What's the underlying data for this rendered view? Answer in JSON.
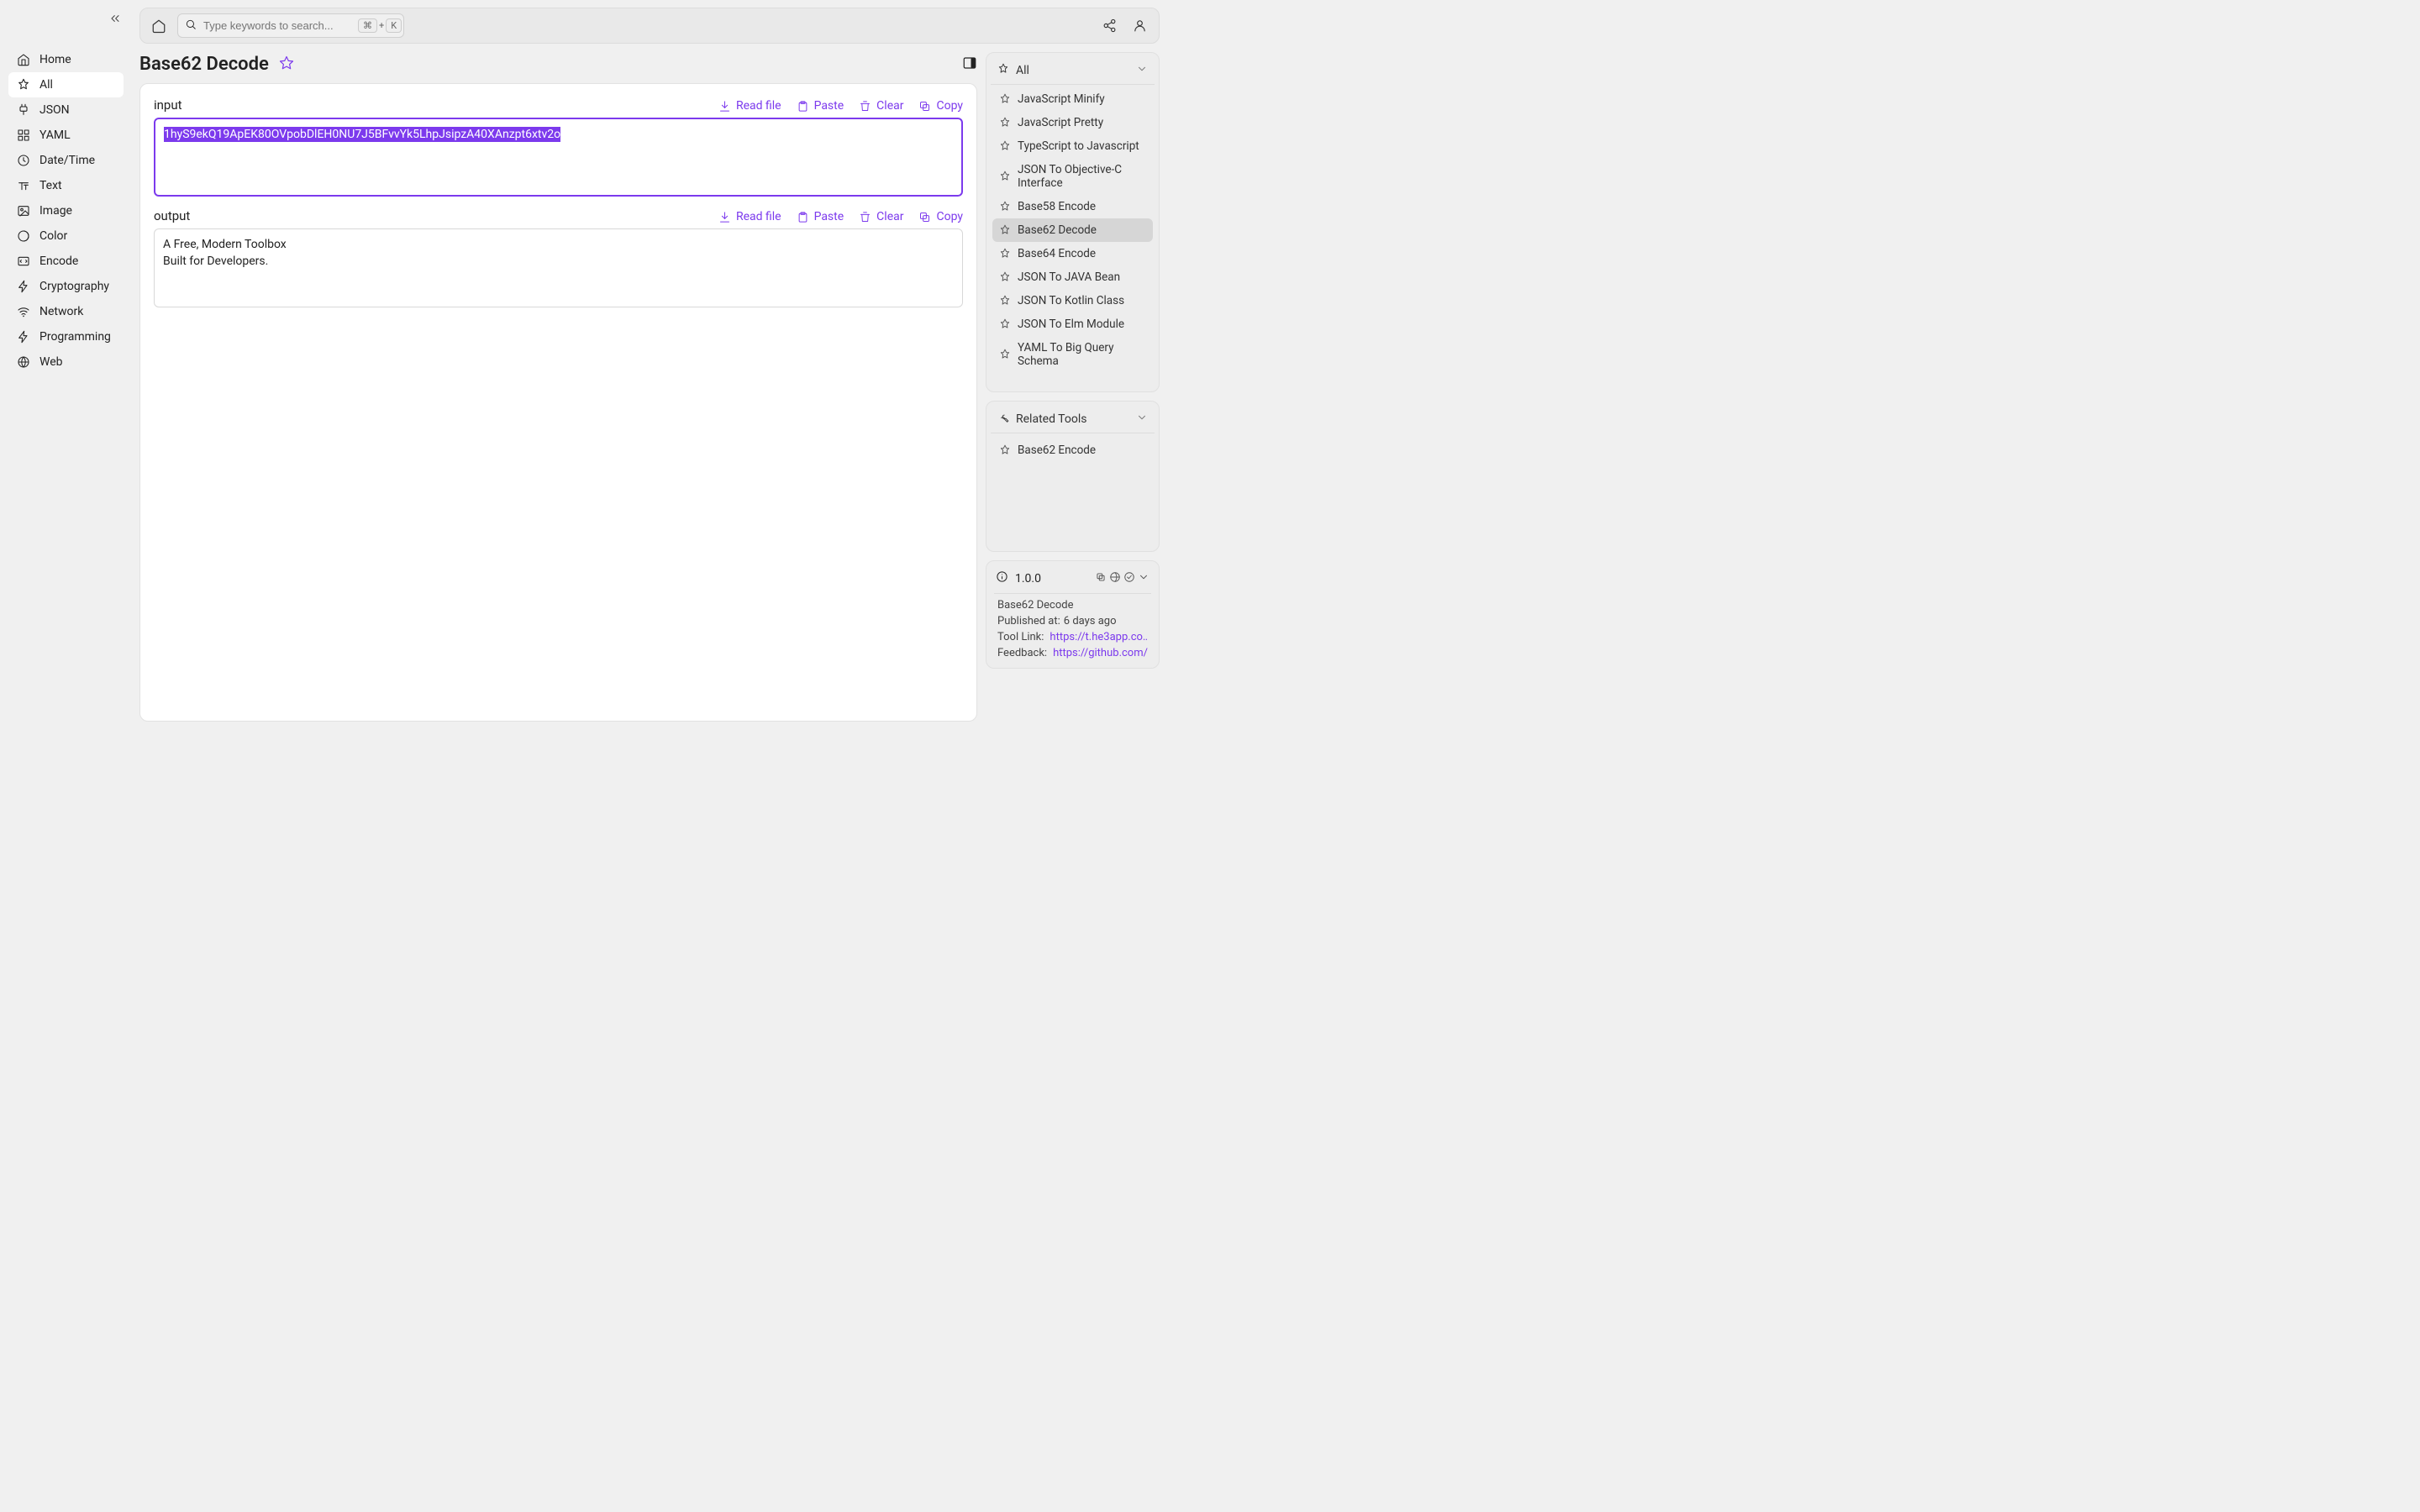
{
  "sidebar": {
    "items": [
      {
        "label": "Home"
      },
      {
        "label": "All"
      },
      {
        "label": "JSON"
      },
      {
        "label": "YAML"
      },
      {
        "label": "Date/Time"
      },
      {
        "label": "Text"
      },
      {
        "label": "Image"
      },
      {
        "label": "Color"
      },
      {
        "label": "Encode"
      },
      {
        "label": "Cryptography"
      },
      {
        "label": "Network"
      },
      {
        "label": "Programming"
      },
      {
        "label": "Web"
      }
    ]
  },
  "search": {
    "placeholder": "Type keywords to search...",
    "kbd1": "⌘",
    "kbd_plus": "+",
    "kbd2": "K"
  },
  "tool": {
    "title": "Base62 Decode",
    "input_label": "input",
    "output_label": "output",
    "input_value": "1hyS9ekQ19ApEK80OVpobDlEH0NU7J5BFvvYk5LhpJsipzA40XAnzpt6xtv2o",
    "output_value": "A Free, Modern Toolbox\nBuilt for Developers.",
    "actions": {
      "read_file": "Read file",
      "paste": "Paste",
      "clear": "Clear",
      "copy": "Copy"
    }
  },
  "right": {
    "all_header": "All",
    "tools": [
      "JavaScript Minify",
      "JavaScript Pretty",
      "TypeScript to Javascript",
      "JSON To Objective-C Interface",
      "Base58 Encode",
      "Base62 Decode",
      "Base64 Encode",
      "JSON To JAVA Bean",
      "JSON To Kotlin Class",
      "JSON To Elm Module",
      "YAML To Big Query Schema"
    ],
    "active_tool_index": 5,
    "related_header": "Related Tools",
    "related": [
      "Base62 Encode"
    ]
  },
  "info": {
    "version": "1.0.0",
    "name": "Base62 Decode",
    "published_label": "Published at:",
    "published_value": "6 days ago",
    "tool_link_label": "Tool Link:",
    "tool_link_value": "https://t.he3app.co…",
    "feedback_label": "Feedback:",
    "feedback_value": "https://github.com/…"
  }
}
